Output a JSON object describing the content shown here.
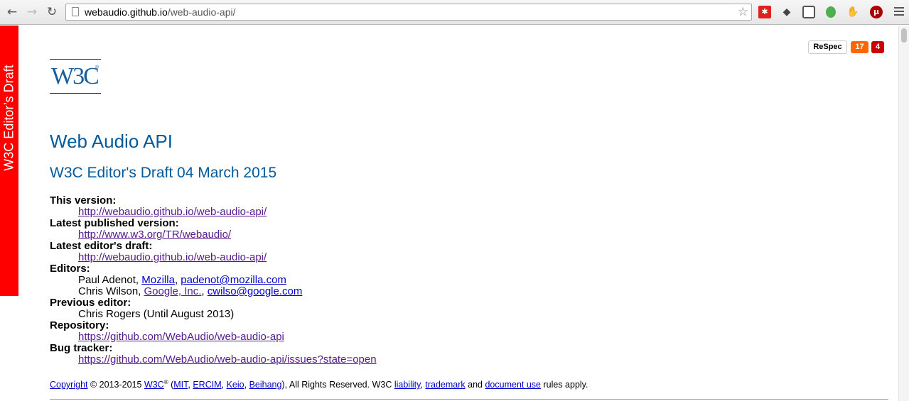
{
  "browser": {
    "url_host": "webaudio.github.io",
    "url_path": "/web-audio-api/"
  },
  "sidebar": {
    "label": "W3C Editor’s Draft"
  },
  "respec": {
    "label": "ReSpec",
    "warnings": "17",
    "errors": "4"
  },
  "logo": {
    "text": "W3C",
    "reg": "®"
  },
  "doc": {
    "title": "Web Audio API",
    "subtitle": "W3C Editor's Draft 04 March 2015",
    "this_version_label": "This version:",
    "this_version_url": "http://webaudio.github.io/web-audio-api/",
    "latest_published_label": "Latest published version:",
    "latest_published_url": "http://www.w3.org/TR/webaudio/",
    "latest_editors_label": "Latest editor's draft:",
    "latest_editors_url": "http://webaudio.github.io/web-audio-api/",
    "editors_label": "Editors:",
    "editor1_name": "Paul Adenot, ",
    "editor1_org": "Mozilla",
    "editor1_email": "padenot@mozilla.com",
    "editor2_name": "Chris Wilson, ",
    "editor2_org": "Google, Inc.",
    "editor2_email": "cwilso@google.com",
    "previous_editor_label": "Previous editor:",
    "previous_editor": "Chris Rogers (Until August 2013)",
    "repository_label": "Repository:",
    "repository_url": "https://github.com/WebAudio/web-audio-api",
    "bug_tracker_label": "Bug tracker:",
    "bug_tracker_url": "https://github.com/WebAudio/web-audio-api/issues?state=open"
  },
  "copyright": {
    "link": "Copyright",
    "years": " © 2013-2015 ",
    "w3c": "W3C",
    "mit": "MIT",
    "ercim": "ERCIM",
    "keio": "Keio",
    "beihang": "Beihang",
    "rights": "), All Rights Reserved. W3C ",
    "liability": "liability",
    "trademark": "trademark",
    "and": " and ",
    "document_use": "document use",
    "tail": " rules apply."
  }
}
